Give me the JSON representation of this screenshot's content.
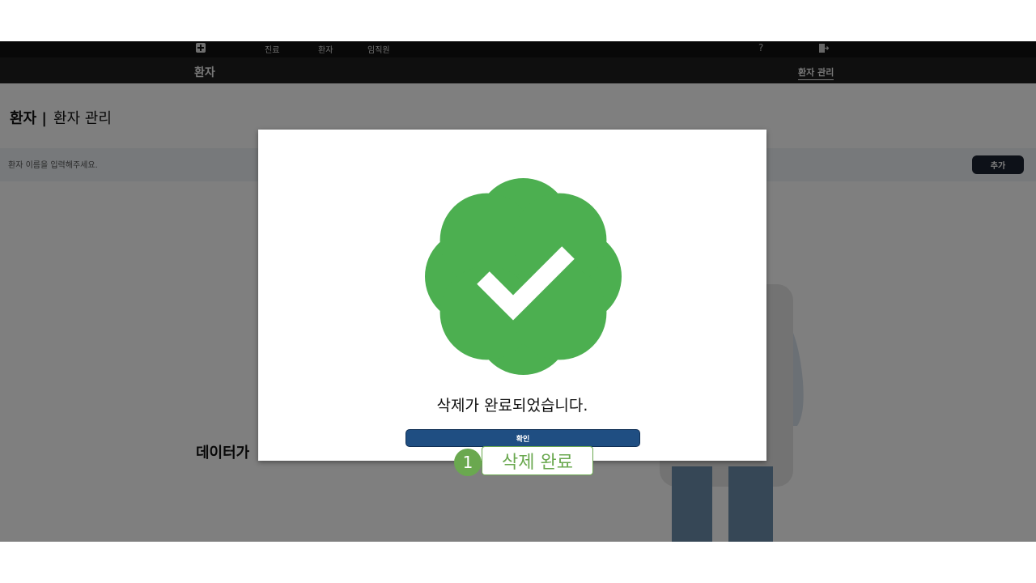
{
  "topnav": {
    "links": [
      "진료",
      "환자",
      "임직원"
    ],
    "help_glyph": "?"
  },
  "subnav": {
    "title": "환자",
    "tab": "환자 관리"
  },
  "page": {
    "title_strong": "환자 |",
    "title_light": "환자 관리",
    "search_placeholder": "환자 이름을 입력해주세요.",
    "add_label": "추가",
    "empty_text": "데이터가"
  },
  "modal": {
    "icon": "check-badge-icon",
    "message": "삭제가 완료되었습니다.",
    "confirm_label": "확인",
    "accent_color": "#4caf50",
    "button_color": "#1f4e82"
  },
  "annotation": {
    "step_number": "1",
    "step_label": "삭제 완료",
    "color": "#6aa84f"
  }
}
